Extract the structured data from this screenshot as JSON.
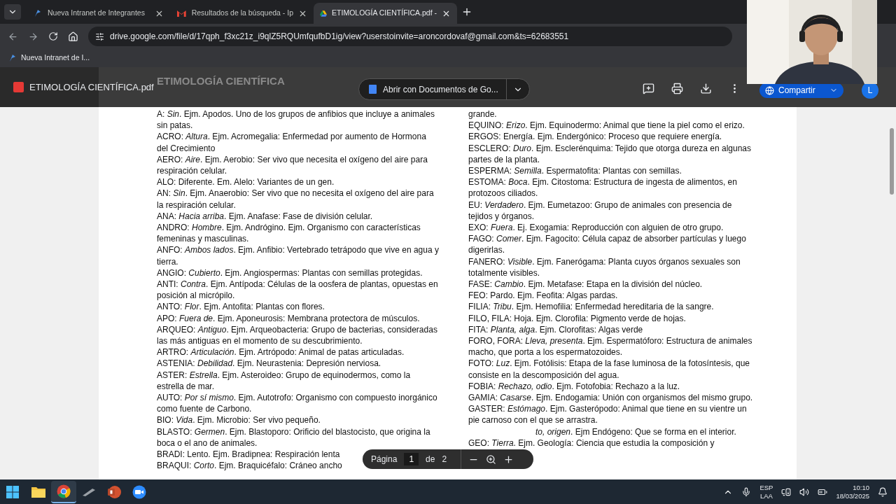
{
  "browser": {
    "tabs": [
      {
        "kind": "intranet",
        "label": "Nueva Intranet de Integrantes",
        "selected": false
      },
      {
        "kind": "gmail",
        "label": "Resultados de la búsqueda - Ip",
        "selected": false
      },
      {
        "kind": "drive",
        "label": "ETIMOLOGÍA CIENTÍFICA.pdf -",
        "selected": true
      }
    ],
    "url": "drive.google.com/file/d/17qph_f3xc21z_i9qlZ5RQUmfqufbD1ig/view?userstoinvite=aroncordovaf@gmail.com&ts=62683551",
    "bookmarks": [
      "Nueva Intranet de I..."
    ]
  },
  "viewer": {
    "file_name": "ETIMOLOGÍA CIENTÍFICA.pdf",
    "doc_heading": "ETIMOLOGÍA CIENTÍFICA",
    "open_with": "Abrir con Documentos de Go...",
    "share": "Compartir",
    "avatar": "L"
  },
  "document": {
    "left_column": [
      {
        "kind": "text",
        "text": "A: *Sin*. Ejm. Apodos. Uno de los grupos de anfibios que incluye a animales sin patas."
      },
      {
        "kind": "text",
        "text": "ACRO: *Altura*. Ejm. Acromegalia: Enfermedad por aumento de Hormona del Crecimiento"
      },
      {
        "kind": "text",
        "text": "AERO: *Aire*. Ejm. Aerobio: Ser vivo que necesita el oxígeno del aire para respiración celular."
      },
      {
        "kind": "text",
        "text": "ALO: Diferente. Em. Alelo: Variantes de un gen."
      },
      {
        "kind": "text",
        "text": "AN: *Sin*. Ejm. Anaerobio: Ser vivo que no necesita el oxígeno del aire para la respiración celular."
      },
      {
        "kind": "text",
        "text": "ANA: *Hacia arriba*. Ejm. Anafase: Fase de división celular."
      },
      {
        "kind": "text",
        "text": "ANDRO: *Hombre*. Ejm. Andrógino. Ejm. Organismo con características femeninas y masculinas."
      },
      {
        "kind": "text",
        "text": "ANFO: *Ambos lados*. Ejm. Anfibio: Vertebrado tetrápodo que vive en agua y tierra."
      },
      {
        "kind": "text",
        "text": "ANGIO: *Cubierto*. Ejm. Angiospermas: Plantas con semillas protegidas."
      },
      {
        "kind": "text",
        "text": "ANTI: *Contra*. Ejm. Antípoda: Células de la oosfera de plantas, opuestas en posición al micrópilo."
      },
      {
        "kind": "text",
        "text": "ANTO: *Flor*. Ejm. Antofita: Plantas con flores."
      },
      {
        "kind": "text",
        "text": "APO: *Fuera de*. Ejm. Aponeurosis: Membrana protectora de músculos."
      },
      {
        "kind": "text",
        "text": "ARQUEO: *Antiguo*. Ejm. Arqueobacteria: Grupo de bacterias, consideradas las más antiguas en el momento de su descubrimiento."
      },
      {
        "kind": "text",
        "text": "ARTRO: *Articulación*. Ejm. Artrópodo: Animal de patas articuladas."
      },
      {
        "kind": "text",
        "text": "ASTENIA: *Debilidad*. Ejm. Neurastenia: Depresión nerviosa."
      },
      {
        "kind": "text",
        "text": "ASTER: *Estrella*. Ejm. Asteroideo: Grupo de equinodermos, como la estrella de mar."
      },
      {
        "kind": "text",
        "text": "AUTO: *Por sí mismo*. Ejm. Autotrofo: Organismo con compuesto inorgánico como fuente de Carbono."
      },
      {
        "kind": "text",
        "text": "BIO: *Vida*. Ejm. Microbio: Ser vivo pequeño."
      },
      {
        "kind": "text",
        "text": "BLASTO: *Germen*. Ejm. Blastoporo: Orificio del blastocisto, que origina la boca o el ano de animales."
      },
      {
        "kind": "text",
        "text": "BRADI: Lento. Ejm. Bradipnea: Respiración lenta"
      },
      {
        "kind": "text",
        "text": "BRAQUI: *Corto*. Ejm. Braquicéfalo: Cráneo ancho"
      }
    ],
    "right_column": [
      {
        "kind": "text",
        "text": "grande."
      },
      {
        "kind": "text",
        "text": "EQUINO: *Erizo*. Ejm. Equinodermo: Animal que tiene la piel como el erizo."
      },
      {
        "kind": "text",
        "text": "ERGOS: Energía. Ejm. Endergónico: Proceso que requiere energía."
      },
      {
        "kind": "text",
        "text": "ESCLERO: *Duro*. Ejm. Esclerénquima: Tejido que otorga dureza en algunas partes de la planta."
      },
      {
        "kind": "text",
        "text": "ESPERMA: *Semilla*. Espermatofita: Plantas con semillas."
      },
      {
        "kind": "text",
        "text": "ESTOMA: *Boca*. Ejm. Citostoma: Estructura de ingesta de alimentos, en protozoos ciliados."
      },
      {
        "kind": "text",
        "text": "EU: *Verdadero*. Ejm. Eumetazoo: Grupo de animales con presencia de tejidos y órganos."
      },
      {
        "kind": "text",
        "text": "EXO: *Fuera*. Ej. Exogamia: Reproducción con alguien de otro grupo."
      },
      {
        "kind": "text",
        "text": "FAGO: *Comer*. Ejm. Fagocito: Célula capaz de absorber partículas y luego digerirlas."
      },
      {
        "kind": "text",
        "text": "FANERO: *Visible*. Ejm. Fanerógama: Planta cuyos órganos sexuales son totalmente visibles."
      },
      {
        "kind": "text",
        "text": "FASE: *Cambio*. Ejm. Metafase: Etapa en la división del núcleo."
      },
      {
        "kind": "text",
        "text": "FEO: Pardo. Ejm. Feofita: Algas pardas."
      },
      {
        "kind": "text",
        "text": "FILIA: *Tribu*. Ejm. Hemofilia: Enfermedad hereditaria de la sangre."
      },
      {
        "kind": "text",
        "text": "FILO, FILA: Hoja. Ejm. Clorofila: Pigmento verde de hojas."
      },
      {
        "kind": "text",
        "text": "FITA: *Planta, alga*. Ejm. Clorofitas: Algas verde"
      },
      {
        "kind": "text",
        "text": "FORO, FORA: *Lleva, presenta*. Ejm. Espermatóforo: Estructura de animales macho, que porta a los espermatozoides."
      },
      {
        "kind": "text",
        "text": "FOTO: *Luz*. Ejm. Fotólisis: Etapa de la fase luminosa de la fotosíntesis, que consiste en la descomposición del agua."
      },
      {
        "kind": "text",
        "text": "FOBIA: *Rechazo, odio*. Ejm. Fotofobia: Rechazo a la luz."
      },
      {
        "kind": "text",
        "text": "GAMIA: *Casarse*. Ejm. Endogamia: Unión con organismos del mismo grupo."
      },
      {
        "kind": "text",
        "text": "GASTER: *Estómago*. Ejm. Gasterópodo: Animal que tiene en su vientre un pie carnoso con el que se arrastra."
      },
      {
        "kind": "partial",
        "text": "*to, origen*. Ejm Endógeno: Que se forma en el interior."
      },
      {
        "kind": "text",
        "text": "GEO: *Tierra*. Ejm.  Geología: Ciencia que estudia la composición y"
      }
    ]
  },
  "pager": {
    "label": "Página",
    "page": "1",
    "of": "de",
    "total": "2"
  },
  "taskbar": {
    "apps": [
      {
        "kind": "explorer",
        "selected": false
      },
      {
        "kind": "chrome",
        "selected": true
      },
      {
        "kind": "pen",
        "selected": false
      },
      {
        "kind": "powerpoint",
        "selected": false
      },
      {
        "kind": "zoom",
        "selected": false
      }
    ],
    "language": "ESP",
    "layout": "LAA",
    "time": "10:10",
    "date": "18/03/2025"
  }
}
